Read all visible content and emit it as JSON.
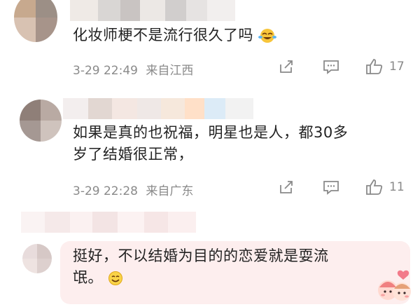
{
  "comments": [
    {
      "text": "化妆师梗不是流行很久了吗",
      "time": "3-29 22:49",
      "location": "来自江西",
      "likes": "17"
    },
    {
      "text_line1": "如果是真的也祝福，明星也是人，都30多",
      "text_line2": "岁了结婚很正常，",
      "time": "3-29 22:28",
      "location": "来自广东",
      "likes": "11"
    },
    {
      "text_line1": "挺好，不以结婚为目的的恋爱就是耍流",
      "text_line2": "氓。"
    }
  ],
  "icons": {
    "share": "share-icon",
    "comment": "comment-icon",
    "like": "thumbs-up-icon"
  },
  "colors": {
    "text": "#222222",
    "meta": "#8a8a8a",
    "bubble": "#fdeeee"
  }
}
